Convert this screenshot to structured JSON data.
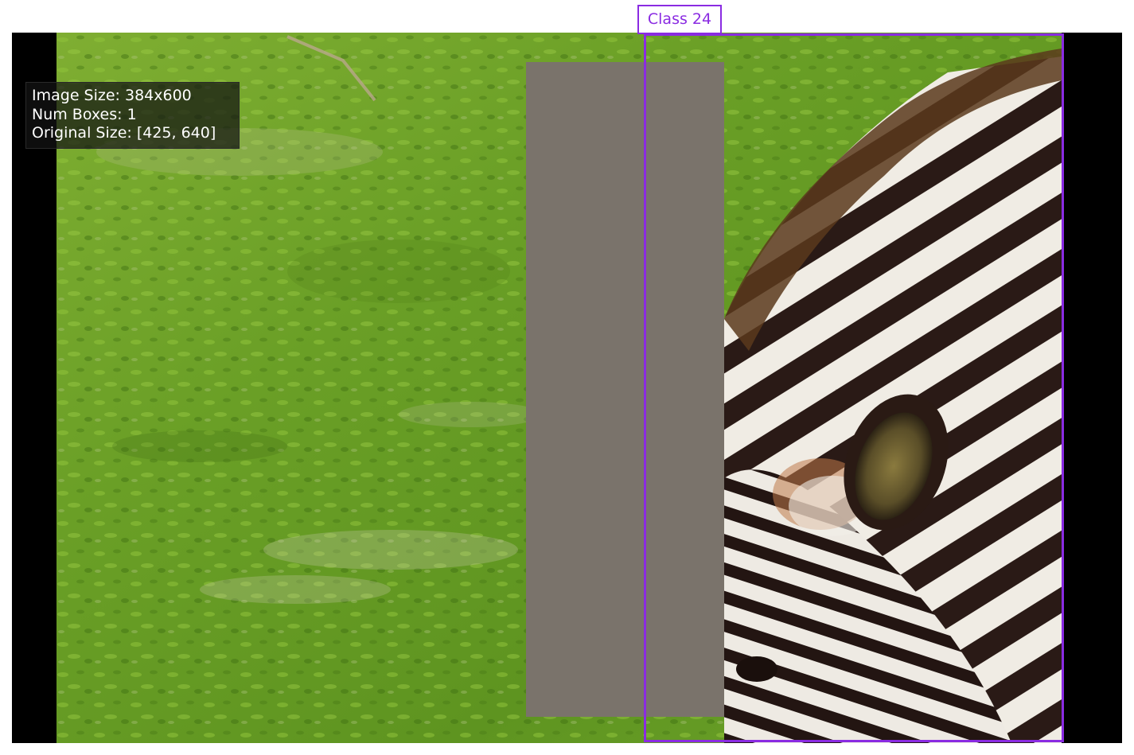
{
  "info": {
    "image_size": "Image Size: 384x600",
    "num_boxes": "Num Boxes: 1",
    "original_size": "Original Size: [425, 640]"
  },
  "detection": {
    "label": "Class 24",
    "color": "#8a2be2"
  },
  "scene": {
    "subject": "zebra-head",
    "background": "grass",
    "occluder_color": "#7a736b"
  }
}
